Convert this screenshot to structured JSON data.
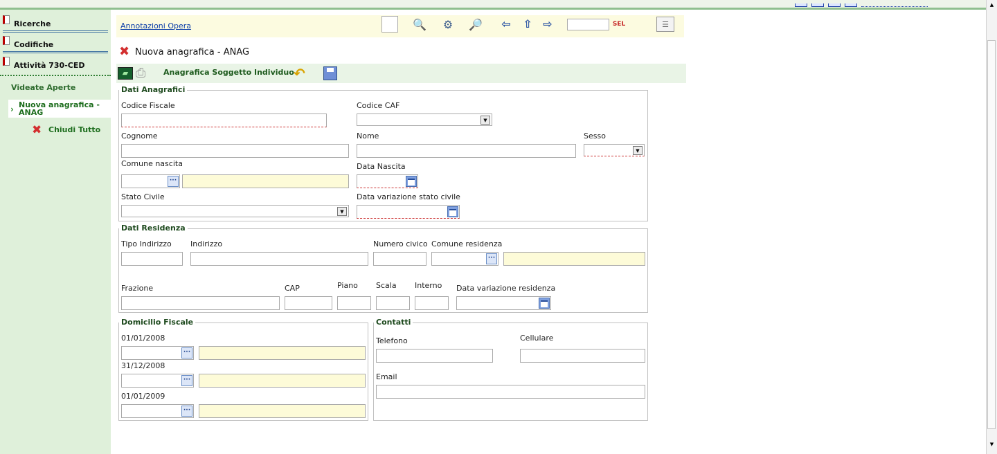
{
  "sidebar": {
    "items": [
      {
        "label": "Ricerche"
      },
      {
        "label": "Codifiche"
      },
      {
        "label": "Attività 730-CED"
      }
    ],
    "open_views_title": "Videate Aperte",
    "open_views": [
      {
        "label": "Nuova anagrafica - ANAG"
      }
    ],
    "close_all": "Chiudi Tutto"
  },
  "toolbar": {
    "link": "Annotazioni Opera",
    "search_value": ""
  },
  "page": {
    "title": "Nuova anagrafica - ANAG",
    "subtitle": "Anagrafica Soggetto Individuo"
  },
  "dati_anagrafici": {
    "legend": "Dati Anagrafici",
    "codice_fiscale": "Codice Fiscale",
    "codice_caf": "Codice CAF",
    "cognome": "Cognome",
    "nome": "Nome",
    "sesso": "Sesso",
    "comune_nascita": "Comune nascita",
    "data_nascita": "Data Nascita",
    "stato_civile": "Stato Civile",
    "data_variazione_stato_civile": "Data variazione stato civile"
  },
  "dati_residenza": {
    "legend": "Dati Residenza",
    "tipo_indirizzo": "Tipo Indirizzo",
    "indirizzo": "Indirizzo",
    "numero_civico": "Numero civico",
    "comune_residenza": "Comune residenza",
    "frazione": "Frazione",
    "cap": "CAP",
    "piano": "Piano",
    "scala": "Scala",
    "interno": "Interno",
    "data_variazione_residenza": "Data variazione residenza"
  },
  "domicilio_fiscale": {
    "legend": "Domicilio Fiscale",
    "dates": [
      "01/01/2008",
      "31/12/2008",
      "01/01/2009"
    ]
  },
  "contatti": {
    "legend": "Contatti",
    "telefono": "Telefono",
    "cellulare": "Cellulare",
    "email": "Email"
  },
  "icons": {
    "toolbar": [
      "blank-box",
      "magnifier-doc-icon",
      "magnifier-gear-icon",
      "magnifier-icon",
      "arrow-left-icon",
      "arrow-up-icon",
      "arrow-right-icon",
      "sel-go-icon",
      "id-card-icon"
    ],
    "sidebar": [
      "book-icon",
      "chevron-right-icon",
      "close-all-icon"
    ],
    "page": [
      "close-icon",
      "monitor-icon",
      "printer-icon",
      "undo-icon",
      "save-icon"
    ]
  },
  "colors": {
    "sidebar_bg": "#dff0da",
    "toolbar_bg": "#fcfbe0",
    "subbar_bg": "#e9f4e6",
    "accent_green": "#1d5a1d",
    "required_red": "#cc3333",
    "lookup_yellow": "#fdfbd8"
  }
}
